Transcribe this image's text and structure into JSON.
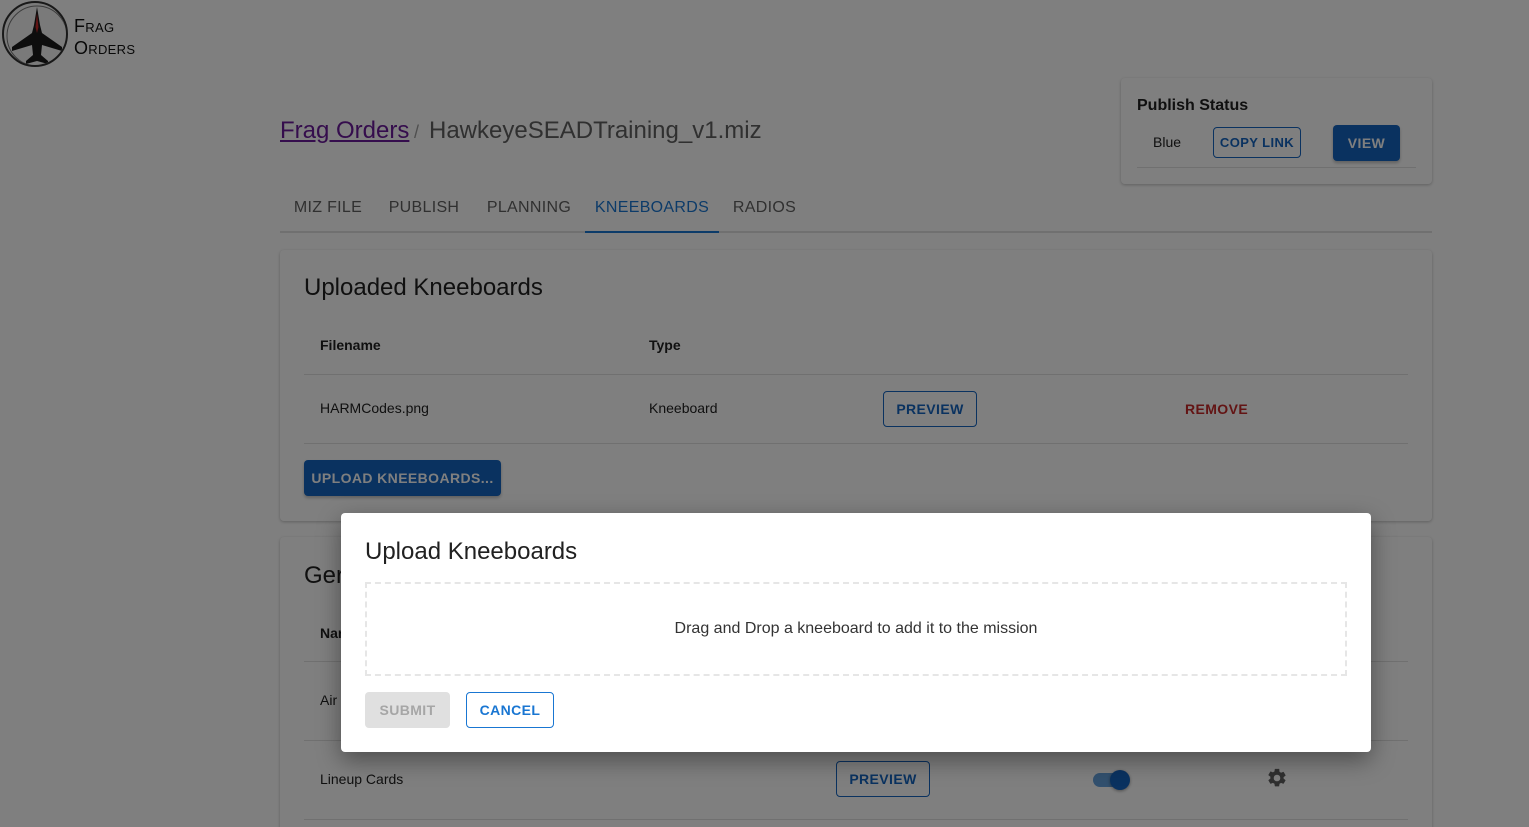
{
  "logo": {
    "line1": "Frag",
    "line2": "Orders"
  },
  "publish_status": {
    "title": "Publish Status",
    "team": "Blue",
    "copy_link_label": "COPY LINK",
    "view_label": "VIEW"
  },
  "breadcrumb": {
    "link": "Frag Orders",
    "separator": "/",
    "current": "HawkeyeSEADTraining_v1.miz"
  },
  "tabs": [
    {
      "label": "MIZ FILE"
    },
    {
      "label": "PUBLISH"
    },
    {
      "label": "PLANNING"
    },
    {
      "label": "KNEEBOARDS",
      "active": true
    },
    {
      "label": "RADIOS"
    }
  ],
  "uploaded": {
    "title": "Uploaded Kneeboards",
    "columns": [
      "Filename",
      "Type"
    ],
    "rows": [
      {
        "filename": "HARMCodes.png",
        "type": "Kneeboard",
        "preview_label": "PREVIEW",
        "remove_label": "REMOVE"
      }
    ],
    "upload_label": "UPLOAD KNEEBOARDS..."
  },
  "generated": {
    "title": "Ger",
    "column_partial": "Nar",
    "rows": [
      {
        "name": "Air"
      },
      {
        "name": "Lineup Cards",
        "preview_label": "PREVIEW",
        "enabled": true
      }
    ]
  },
  "dialog": {
    "title": "Upload Kneeboards",
    "dropzone_text": "Drag and Drop a kneeboard to add it to the mission",
    "submit_label": "SUBMIT",
    "cancel_label": "CANCEL"
  },
  "colors": {
    "primary": "#1565c0",
    "danger": "#c62828",
    "link": "#6a1b9a"
  }
}
